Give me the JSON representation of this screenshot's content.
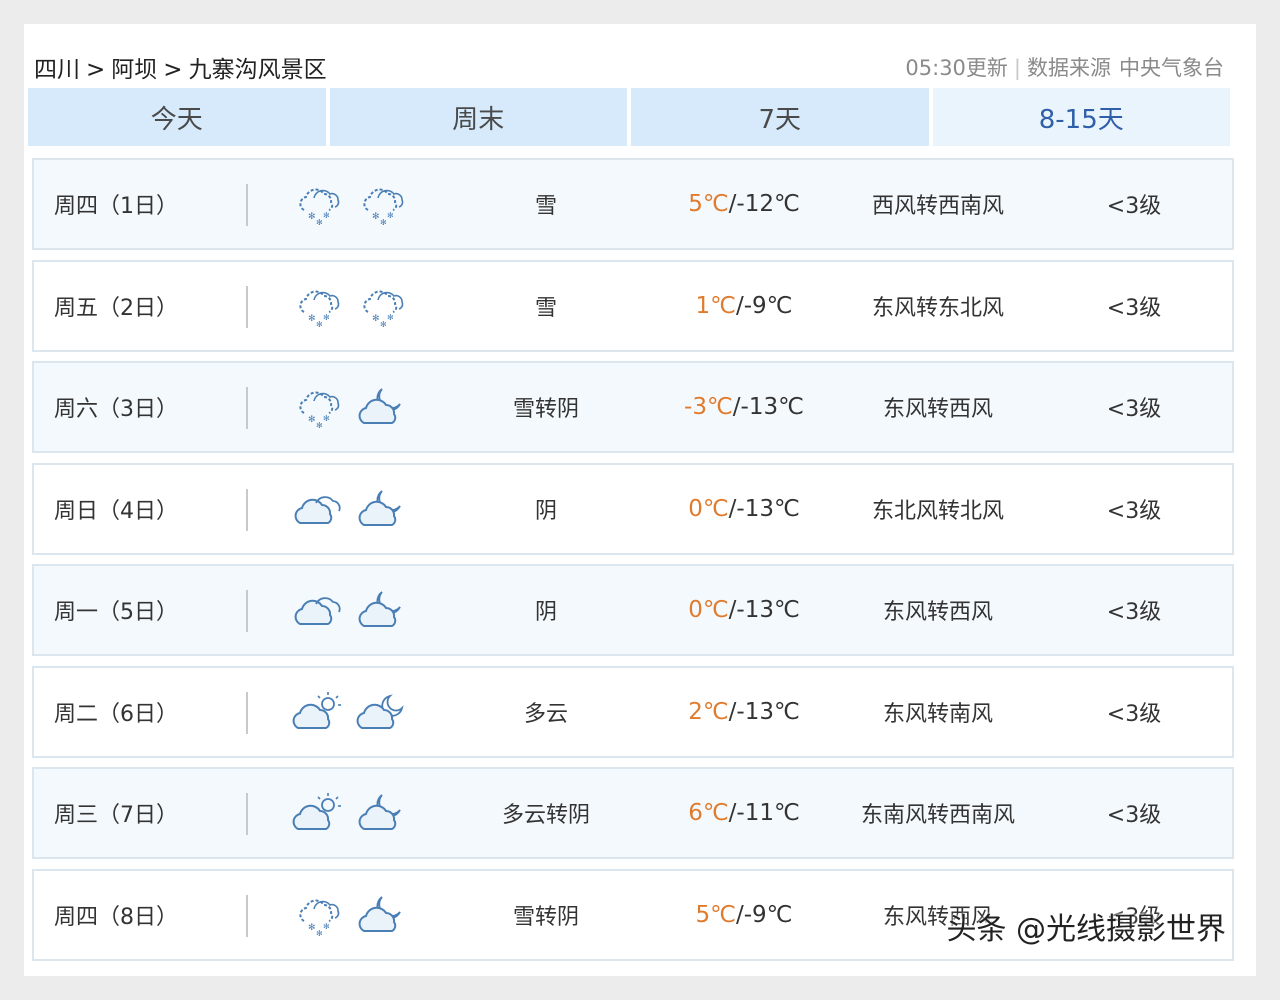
{
  "breadcrumb": {
    "province": "四川",
    "city": "阿坝",
    "area": "九寨沟风景区",
    "separator": ">"
  },
  "meta": {
    "update": "05:30更新",
    "source_label": "数据来源",
    "source": "中央气象台"
  },
  "tabs": [
    {
      "label": "今天",
      "active": false
    },
    {
      "label": "周末",
      "active": false
    },
    {
      "label": "7天",
      "active": false
    },
    {
      "label": "8-15天",
      "active": true
    }
  ],
  "colors": {
    "tab_bg": "#d6eafb",
    "tab_active_text": "#2f5fa8",
    "high_temp": "#e07b2e",
    "icon_stroke": "#4a7fb5"
  },
  "forecast": [
    {
      "day": "周四（1日）",
      "icon_day": "snow-icon",
      "icon_night": "snow-icon",
      "desc": "雪",
      "high": "5℃",
      "low": "/-12℃",
      "wind": "西风转西南风",
      "level": "<3级"
    },
    {
      "day": "周五（2日）",
      "icon_day": "snow-icon",
      "icon_night": "snow-icon",
      "desc": "雪",
      "high": "1℃",
      "low": "/-9℃",
      "wind": "东风转东北风",
      "level": "<3级"
    },
    {
      "day": "周六（3日）",
      "icon_day": "snow-icon",
      "icon_night": "cloudy-night-icon",
      "desc": "雪转阴",
      "high": "-3℃",
      "low": "/-13℃",
      "wind": "东风转西风",
      "level": "<3级"
    },
    {
      "day": "周日（4日）",
      "icon_day": "overcast-icon",
      "icon_night": "cloudy-night-icon",
      "desc": "阴",
      "high": "0℃",
      "low": "/-13℃",
      "wind": "东北风转北风",
      "level": "<3级"
    },
    {
      "day": "周一（5日）",
      "icon_day": "overcast-icon",
      "icon_night": "cloudy-night-icon",
      "desc": "阴",
      "high": "0℃",
      "low": "/-13℃",
      "wind": "东风转西风",
      "level": "<3级"
    },
    {
      "day": "周二（6日）",
      "icon_day": "partly-cloudy-day-icon",
      "icon_night": "partly-cloudy-night-icon",
      "desc": "多云",
      "high": "2℃",
      "low": "/-13℃",
      "wind": "东风转南风",
      "level": "<3级"
    },
    {
      "day": "周三（7日）",
      "icon_day": "partly-cloudy-day-icon",
      "icon_night": "cloudy-night-icon",
      "desc": "多云转阴",
      "high": "6℃",
      "low": "/-11℃",
      "wind": "东南风转西南风",
      "level": "<3级"
    },
    {
      "day": "周四（8日）",
      "icon_day": "snow-icon",
      "icon_night": "cloudy-night-icon",
      "desc": "雪转阴",
      "high": "5℃",
      "low": "/-9℃",
      "wind": "东风转西风",
      "level": "<3级"
    }
  ],
  "watermark": "头条 @光线摄影世界"
}
